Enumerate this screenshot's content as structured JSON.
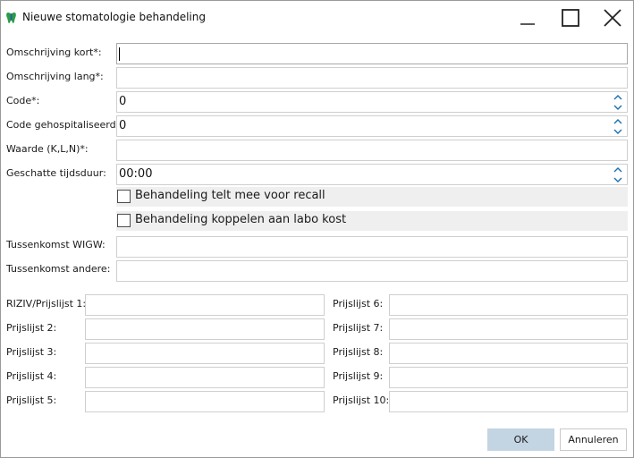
{
  "window": {
    "title": "Nieuwe stomatologie behandeling",
    "app_icon": "tooth-icon",
    "accent_color": "#c3d4e3"
  },
  "form": {
    "omschrijving_kort": {
      "label": "Omschrijving kort*:",
      "value": ""
    },
    "omschrijving_lang": {
      "label": "Omschrijving lang*:",
      "value": ""
    },
    "code": {
      "label": "Code*:",
      "value": "0"
    },
    "code_gehospitaliseerd": {
      "label": "Code gehospitaliseerd*:",
      "value": "0"
    },
    "waarde": {
      "label": "Waarde (K,L,N)*:",
      "value": ""
    },
    "geschatte_tijdsduur": {
      "label": "Geschatte tijdsduur:",
      "value": "00:00"
    },
    "recall": {
      "label": "Behandeling telt mee voor recall",
      "checked": false
    },
    "labo_kost": {
      "label": "Behandeling koppelen aan labo kost",
      "checked": false
    },
    "tussenkomst_wigw": {
      "label": "Tussenkomst WIGW:",
      "value": ""
    },
    "tussenkomst_andere": {
      "label": "Tussenkomst andere:",
      "value": ""
    }
  },
  "prijslijsten": {
    "left": [
      {
        "label": "RIZIV/Prijslijst 1:",
        "value": ""
      },
      {
        "label": "Prijslijst 2:",
        "value": ""
      },
      {
        "label": "Prijslijst 3:",
        "value": ""
      },
      {
        "label": "Prijslijst 4:",
        "value": ""
      },
      {
        "label": "Prijslijst 5:",
        "value": ""
      }
    ],
    "right": [
      {
        "label": "Prijslijst 6:",
        "value": ""
      },
      {
        "label": "Prijslijst 7:",
        "value": ""
      },
      {
        "label": "Prijslijst 8:",
        "value": ""
      },
      {
        "label": "Prijslijst 9:",
        "value": ""
      },
      {
        "label": "Prijslijst 10:",
        "value": ""
      }
    ]
  },
  "buttons": {
    "ok": "OK",
    "cancel": "Annuleren"
  }
}
